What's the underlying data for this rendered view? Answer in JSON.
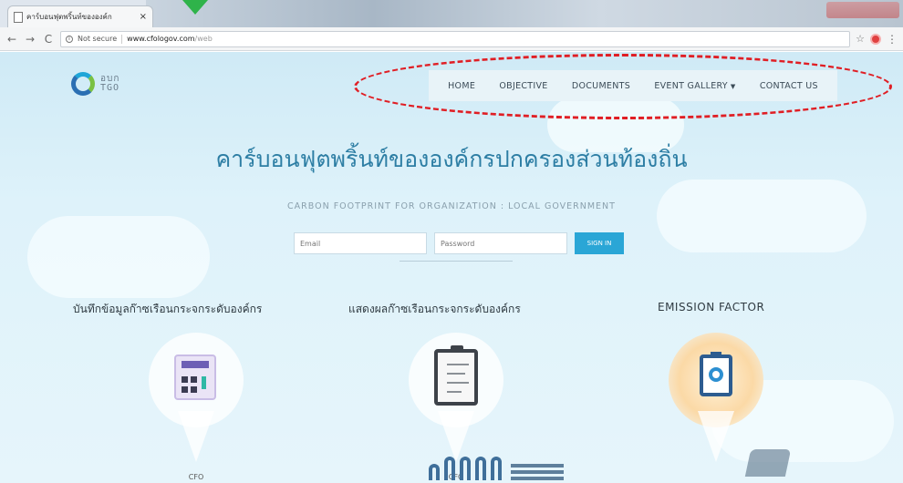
{
  "browser": {
    "tab_title": "คาร์บอนฟุตพริ้นท์ขององค์ก",
    "tab_close": "×",
    "back": "←",
    "forward": "→",
    "reload": "C",
    "security_label": "Not secure",
    "url_host": "www.cfologov.com",
    "url_path": "/web",
    "star": "☆"
  },
  "logo": {
    "line1": "อบก",
    "line2": "TGO"
  },
  "nav": {
    "home": "HOME",
    "objective": "OBJECTIVE",
    "documents": "DOCUMENTS",
    "event_gallery": "EVENT GALLERY",
    "contact_us": "CONTACT US"
  },
  "hero": {
    "title": "คาร์บอนฟุตพริ้นท์ขององค์กรปกครองส่วนท้องถิ่น",
    "subtitle": "CARBON FOOTPRINT FOR ORGANIZATION : LOCAL GOVERNMENT"
  },
  "login": {
    "email_placeholder": "Email",
    "password_placeholder": "Password",
    "signin_label": "SIGN IN"
  },
  "sections": [
    {
      "title": "บันทึกข้อมูลก๊าซเรือนกระจกระดับองค์กร",
      "caption": "CFO"
    },
    {
      "title": "แสดงผลก๊าซเรือนกระจกระดับองค์กร",
      "caption": "CFO"
    },
    {
      "title": "EMISSION FACTOR",
      "caption": ""
    }
  ],
  "colors": {
    "accent": "#2d7ea4",
    "signin": "#2aa6d6",
    "annotation": "#e01e24"
  }
}
